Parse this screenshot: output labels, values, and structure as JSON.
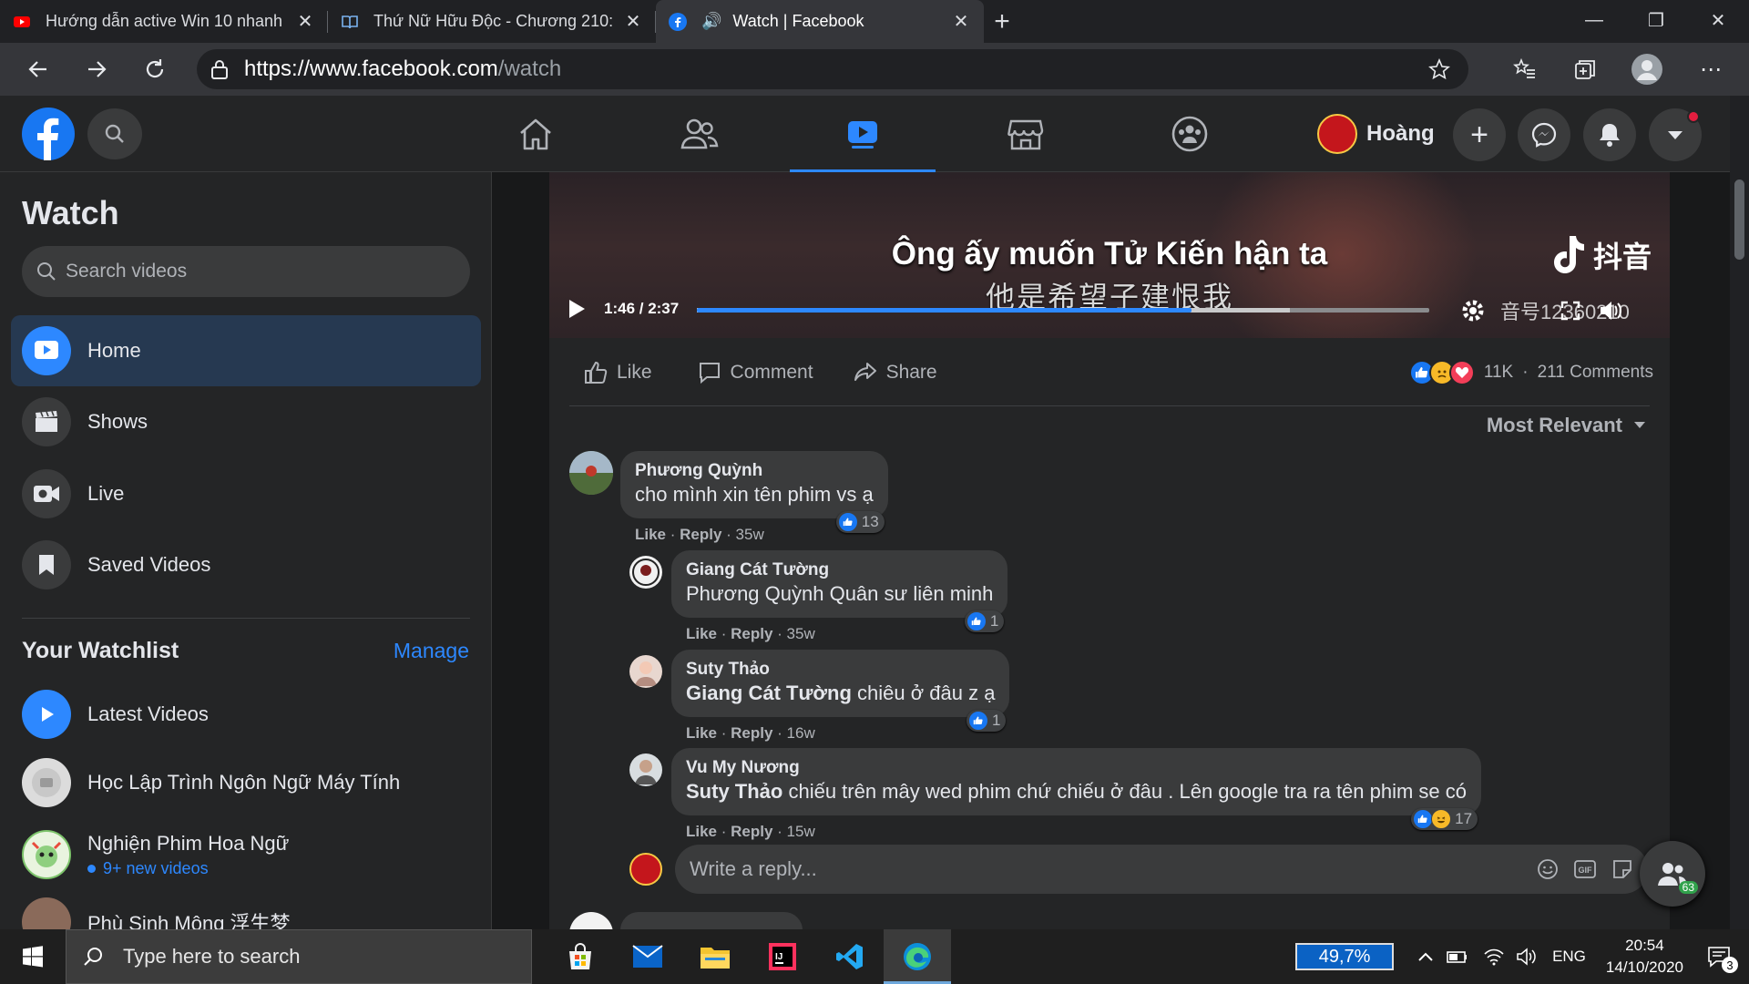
{
  "browser": {
    "tabs": [
      {
        "title": "Hướng dẫn active Win 10 nhanh",
        "icon": "youtube-icon"
      },
      {
        "title": "Thứ Nữ Hữu Độc - Chương 210:",
        "icon": "book-icon"
      },
      {
        "title": "Watch | Facebook",
        "icon": "facebook-icon",
        "active": true
      }
    ],
    "url_host": "https://www.facebook.com",
    "url_path": "/watch"
  },
  "fb_nav": {
    "profile_name": "Hoàng"
  },
  "sidebar": {
    "title": "Watch",
    "search_placeholder": "Search videos",
    "items": [
      {
        "label": "Home",
        "icon": "play-icon",
        "active": true
      },
      {
        "label": "Shows",
        "icon": "clapperboard-icon"
      },
      {
        "label": "Live",
        "icon": "live-camera-icon"
      },
      {
        "label": "Saved Videos",
        "icon": "bookmark-icon"
      }
    ],
    "watchlist_title": "Your Watchlist",
    "manage_label": "Manage",
    "watchlist": [
      {
        "label": "Latest Videos"
      },
      {
        "label": "Học Lập Trình Ngôn Ngữ Máy Tính"
      },
      {
        "label": "Nghiện Phim Hoa Ngữ",
        "sub": "9+ new videos"
      },
      {
        "label": "Phù Sinh Mộng 浮生梦"
      }
    ]
  },
  "video": {
    "subtitle_vi": "Ông ấy muốn Tử Kiến hận ta",
    "subtitle_zh": "他是希望子建恨我",
    "brand": "抖音",
    "watermark": "音号12360210",
    "time": "1:46 / 2:37",
    "progress": 0.675
  },
  "post_actions": {
    "like": "Like",
    "comment": "Comment",
    "share": "Share",
    "reactions_count": "11K",
    "comments_count": "211 Comments",
    "sort_label": "Most Relevant"
  },
  "comments": [
    {
      "name": "Phương Quỳnh",
      "text": "cho mình xin tên phim vs ạ",
      "meta_like": "Like",
      "meta_reply": "Reply",
      "meta_time": "35w",
      "react_count": "13"
    },
    {
      "name": "Giang Cát Tường",
      "text": "Phương Quỳnh Quân sư liên minh",
      "meta_like": "Like",
      "meta_reply": "Reply",
      "meta_time": "35w",
      "react_count": "1"
    },
    {
      "name": "Suty Thảo",
      "mention": "Giang Cát Tường",
      "text": " chiêu ở đâu z ạ",
      "meta_like": "Like",
      "meta_reply": "Reply",
      "meta_time": "16w",
      "react_count": "1"
    },
    {
      "name": "Vu My Nương",
      "mention": "Suty Thảo",
      "text": " chiếu trên mây wed phim chứ chiếu ở đâu . Lên google tra ra tên phim se có",
      "meta_like": "Like",
      "meta_reply": "Reply",
      "meta_time": "15w",
      "react_count": "17"
    }
  ],
  "reply_placeholder": "Write a reply...",
  "contacts_badge": "63",
  "taskbar": {
    "search_placeholder": "Type here to search",
    "battery": "49,7%",
    "lang": "ENG",
    "time": "20:54",
    "date": "14/10/2020",
    "notif_count": "3"
  }
}
